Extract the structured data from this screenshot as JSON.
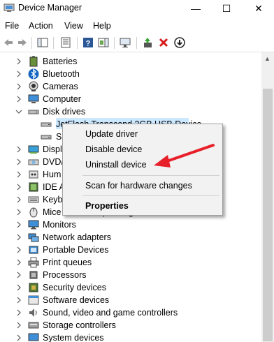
{
  "window": {
    "title": "Device Manager",
    "minimize": "—",
    "maximize": "☐",
    "close": "✕"
  },
  "menu": [
    "File",
    "Action",
    "View",
    "Help"
  ],
  "tree": {
    "items": [
      {
        "label": "Batteries"
      },
      {
        "label": "Bluetooth"
      },
      {
        "label": "Cameras"
      },
      {
        "label": "Computer"
      },
      {
        "label": "Disk drives"
      },
      {
        "label": "JetFlash Transcend 2GB USB Device"
      },
      {
        "label": "S"
      },
      {
        "label": "Displ"
      },
      {
        "label": "DVD/"
      },
      {
        "label": "Hum"
      },
      {
        "label": "IDE A"
      },
      {
        "label": "Keyb"
      },
      {
        "label": "Mice and other pointing devices"
      },
      {
        "label": "Monitors"
      },
      {
        "label": "Network adapters"
      },
      {
        "label": "Portable Devices"
      },
      {
        "label": "Print queues"
      },
      {
        "label": "Processors"
      },
      {
        "label": "Security devices"
      },
      {
        "label": "Software devices"
      },
      {
        "label": "Sound, video and game controllers"
      },
      {
        "label": "Storage controllers"
      },
      {
        "label": "System devices"
      }
    ]
  },
  "context_menu": {
    "update": "Update driver",
    "disable": "Disable device",
    "uninstall": "Uninstall device",
    "scan": "Scan for hardware changes",
    "properties": "Properties"
  },
  "colors": {
    "arrow": "#e8202a",
    "highlight": "#cce8ff",
    "help_icon": "#2b5797"
  }
}
